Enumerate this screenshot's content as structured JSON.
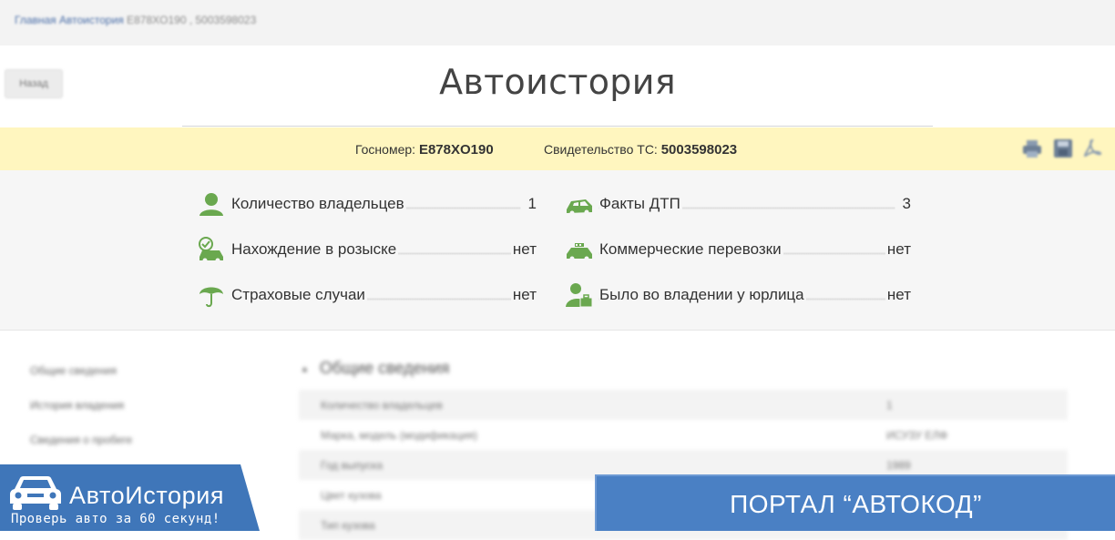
{
  "breadcrumb": {
    "link": "Главная Автоистория",
    "rest": " E878XO190 , 5003598023"
  },
  "back_label": "Назад",
  "page_title": "Автоистория",
  "identity": {
    "plate_label": "Госномер:",
    "plate_value": "E878XO190",
    "cert_label": "Свидетельство ТС:",
    "cert_value": "5003598023"
  },
  "summary": {
    "left": [
      {
        "label": "Количество владельцев",
        "value": "1",
        "icon": "owner-icon"
      },
      {
        "label": "Нахождение в розыске",
        "value": "нет",
        "icon": "search-check-car-icon"
      },
      {
        "label": "Страховые случаи",
        "value": "нет",
        "icon": "umbrella-icon"
      }
    ],
    "right": [
      {
        "label": "Факты ДТП",
        "value": "3",
        "icon": "crash-car-icon"
      },
      {
        "label": "Коммерческие перевозки",
        "value": "нет",
        "icon": "taxi-icon"
      },
      {
        "label": "Было во владении у юрлица",
        "value": "нет",
        "icon": "business-owner-icon"
      }
    ]
  },
  "sidenav": [
    "Общие сведения",
    "История владения",
    "Сведения о пробеге"
  ],
  "section": {
    "title": "Общие сведения",
    "rows": [
      {
        "key": "Количество владельцев",
        "value": "1"
      },
      {
        "key": "Марка, модель (модификация)",
        "value": "ИСУЗУ ЕЛФ"
      },
      {
        "key": "Год выпуска",
        "value": "1989"
      },
      {
        "key": "Цвет кузова",
        "value": ""
      },
      {
        "key": "Тип кузова",
        "value": ""
      }
    ]
  },
  "logo": {
    "name": "АвтоИстория",
    "tagline": "Проверь авто за 60 секунд!"
  },
  "portal_banner": "ПОРТАЛ “АВТОКОД”",
  "colors": {
    "icon_green": "#6aa84f",
    "id_bar": "#fff6bf",
    "banner_blue": "#3f76b9"
  }
}
